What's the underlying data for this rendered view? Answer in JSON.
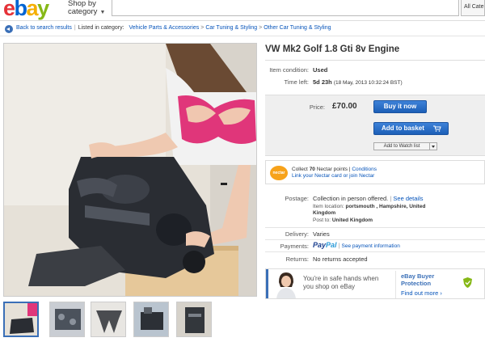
{
  "header": {
    "logo_letters": [
      {
        "ch": "e",
        "color": "#e53238"
      },
      {
        "ch": "b",
        "color": "#0064d2"
      },
      {
        "ch": "a",
        "color": "#f5af02"
      },
      {
        "ch": "y",
        "color": "#86b817"
      }
    ],
    "shop_by_line1": "Shop by",
    "shop_by_line2": "category",
    "category_select": "All Cate"
  },
  "breadcrumb": {
    "back_label": "Back to search results",
    "listed_in": "Listed in category:",
    "path": [
      "Vehicle Parts & Accessories",
      "Car Tuning & Styling",
      "Other Car Tuning & Styling"
    ]
  },
  "item": {
    "title": "VW Mk2 Golf 1.8 Gti 8v Engine",
    "condition_label": "Item condition:",
    "condition_value": "Used",
    "time_left_label": "Time left:",
    "time_left_value": "5d 23h",
    "time_left_end": "(18 May, 2013  10:32:24 BST)",
    "price_label": "Price:",
    "price_value": "£70.00",
    "buy_now": "Buy it now",
    "add_to_basket": "Add to basket",
    "watch_list": "Add to Watch list"
  },
  "nectar": {
    "logo_text": "nectar",
    "line1_prefix": "Collect ",
    "points": "70",
    "line1_mid": " Nectar points | ",
    "conditions": "Conditions",
    "link_text": "Link your Nectar card or join Nectar"
  },
  "details": {
    "postage_label": "Postage:",
    "postage_value": "Collection in person offered.",
    "see_details": "See details",
    "item_location_label": "Item location:",
    "item_location_value": "portsmouth , Hampshire, United",
    "item_location_value2": "Kingdom",
    "post_to_label": "Post to:",
    "post_to_value": "United Kingdom",
    "delivery_label": "Delivery:",
    "delivery_value": "Varies",
    "payments_label": "Payments:",
    "paypal_pay": "Pay",
    "paypal_pal": "Pal",
    "payment_info": "See payment information",
    "returns_label": "Returns:",
    "returns_value": "No returns accepted"
  },
  "protection": {
    "line1": "You're in safe hands when",
    "line2": "you shop on eBay",
    "title_line1": "eBay Buyer",
    "title_line2": "Protection",
    "find_out": "Find out more ›"
  },
  "colors": {
    "link": "#0654ba",
    "button_blue": "#1c5fb7",
    "price_panel": "#efefef"
  }
}
